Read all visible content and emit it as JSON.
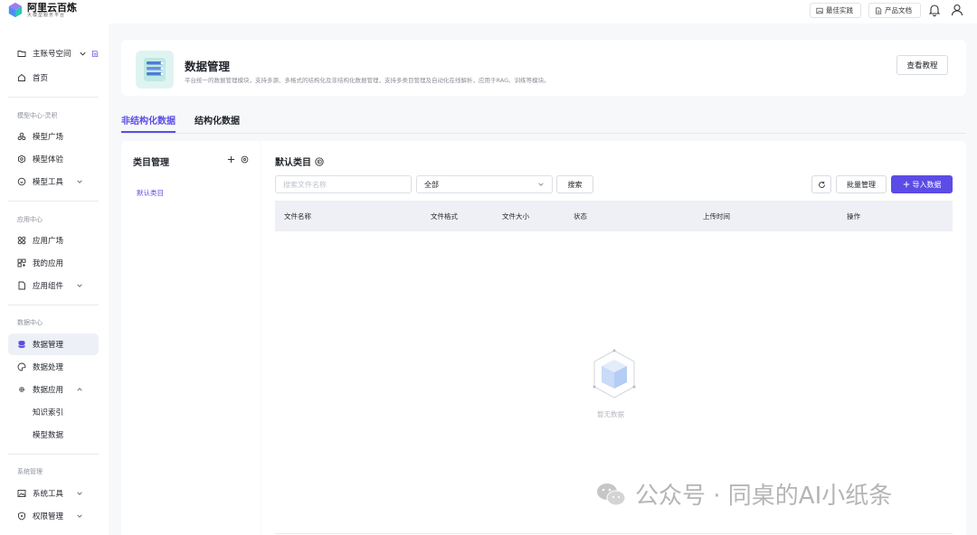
{
  "header": {
    "logo_name": "阿里云百炼",
    "logo_sub": "大模型服务平台",
    "best_practice": "最佳实践",
    "product_docs": "产品文档"
  },
  "sidebar": {
    "workspace": "主账号空间",
    "home": "首页",
    "group_model": "模型中心-灵积",
    "model_square": "模型广场",
    "model_experience": "模型体验",
    "model_tools": "模型工具",
    "group_app": "应用中心",
    "app_square": "应用广场",
    "my_apps": "我的应用",
    "app_components": "应用组件",
    "group_data": "数据中心",
    "data_management": "数据管理",
    "data_processing": "数据处理",
    "data_application": "数据应用",
    "knowledge_index": "知识索引",
    "model_data": "模型数据",
    "group_system": "系统管理",
    "system_tools": "系统工具",
    "permission_management": "权限管理"
  },
  "page": {
    "title": "数据管理",
    "description": "平台统一的数据管理模块，支持多源、多格式的结构化及非结构化数据管理，支持多类目管理及自动化在线解析，应用于RAG、训练等模块。",
    "tutorial_button": "查看教程",
    "tabs": [
      "非结构化数据",
      "结构化数据"
    ]
  },
  "category": {
    "title": "类目管理",
    "items": [
      "默认类目"
    ]
  },
  "content": {
    "title": "默认类目",
    "search_placeholder": "搜索文件名称",
    "filter_value": "全部",
    "search_button": "搜索",
    "batch_button": "批量管理",
    "import_button": "导入数据",
    "columns": [
      "文件名称",
      "文件格式",
      "文件大小",
      "状态",
      "上传时间",
      "操作"
    ],
    "empty_text": "暂无数据"
  },
  "watermark": {
    "text": "公众号 · 同桌的AI小纸条"
  },
  "colors": {
    "accent": "#5b4ce6",
    "nav_active_bg": "#eef0f7",
    "table_header_bg": "#eef0f5"
  }
}
